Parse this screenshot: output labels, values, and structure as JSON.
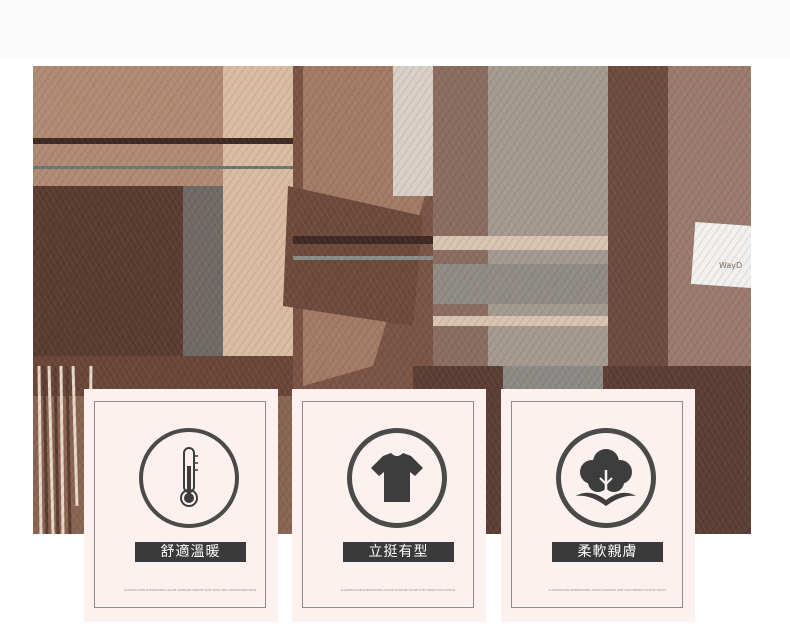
{
  "features": [
    {
      "icon": "thermometer-icon",
      "label": "舒適溫暖",
      "fine_print": "CLASSIFICATION INTERNATIONAL GRADE STANDARD WARMTH SOFT WOOL FEEL COMFORTABLE WEAR"
    },
    {
      "icon": "tshirt-icon",
      "label": "立挺有型",
      "fine_print": "CLASSIFICATION INTERNATIONAL GRADE STANDARD SHAPE STIFF FABRIC STYLE DESIGN"
    },
    {
      "icon": "cotton-plant-icon",
      "label": "柔軟親膚",
      "fine_print": "CLASSIFICATION INTERNATIONAL GRADE STANDARD SOFT SKIN FRIENDLY COTTON TOUCH"
    }
  ],
  "colors": {
    "card_background": "#fcf1ee",
    "label_background": "#3a3a3a",
    "icon_fill": "#3d3d3d",
    "icon_ring": "#4a4a4a"
  }
}
